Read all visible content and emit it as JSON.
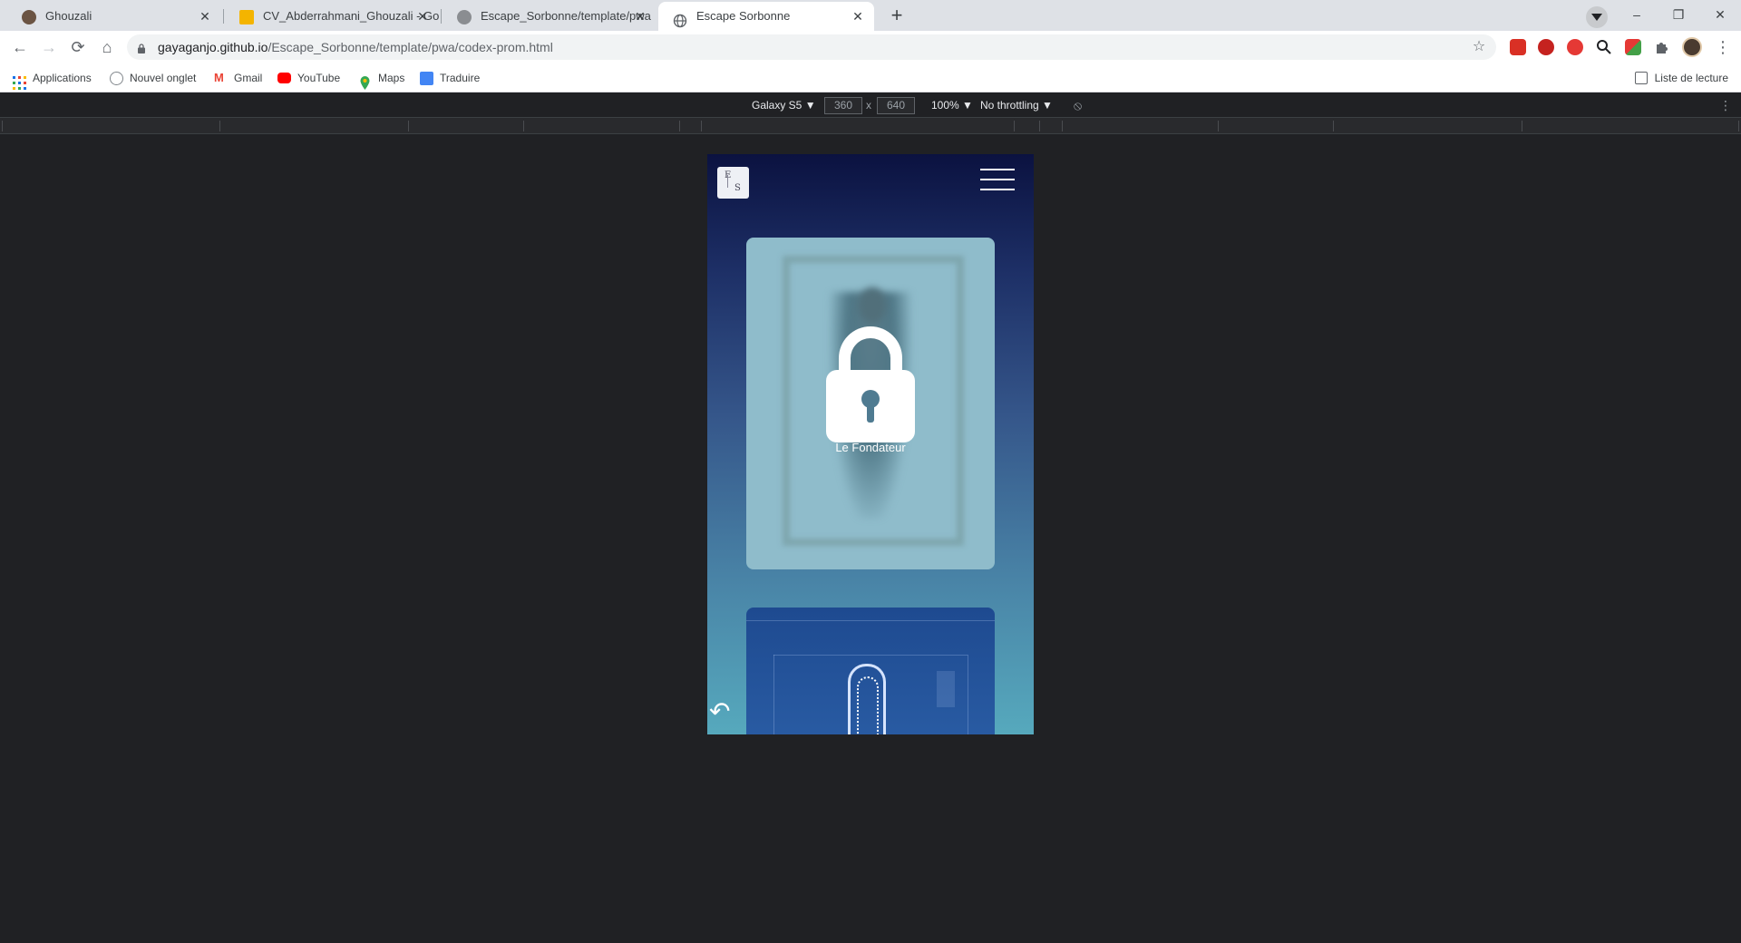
{
  "browser": {
    "tabs": [
      {
        "title": "Ghouzali",
        "active": false
      },
      {
        "title": "CV_Abderrahmani_Ghouzali - Go",
        "active": false
      },
      {
        "title": "Escape_Sorbonne/template/pwa",
        "active": false
      },
      {
        "title": "Escape Sorbonne",
        "active": true
      }
    ],
    "close_glyph": "✕",
    "new_tab_glyph": "+",
    "window_controls": {
      "minimize": "–",
      "restore": "❐",
      "close": "✕"
    },
    "nav": {
      "back": "←",
      "forward": "→",
      "reload": "⟳",
      "home": "⌂"
    },
    "url_host": "gayaganjo.github.io",
    "url_path": "/Escape_Sorbonne/template/pwa/codex-prom.html",
    "star_glyph": "☆",
    "bookmarks": [
      "Applications",
      "Nouvel onglet",
      "Gmail",
      "YouTube",
      "Maps",
      "Traduire"
    ],
    "reading_list": "Liste de lecture"
  },
  "devtools": {
    "device": "Galaxy S5 ▼",
    "width": "360",
    "times": "x",
    "height": "640",
    "zoom": "100% ▼",
    "throttling": "No throttling ▼",
    "rotate_glyph": "⃠",
    "more_glyph": "⋮"
  },
  "app": {
    "logo_letters": [
      "E",
      "S"
    ],
    "cards": [
      {
        "label": "Le Fondateur",
        "locked": true
      },
      {
        "label": "",
        "locked": false
      }
    ],
    "back_glyph": "↶"
  },
  "colors": {
    "gradient_top": "#0b1240",
    "gradient_bottom": "#56a9bd",
    "card_locked": "#8fbccb",
    "keyhole": "#4f7b91"
  }
}
